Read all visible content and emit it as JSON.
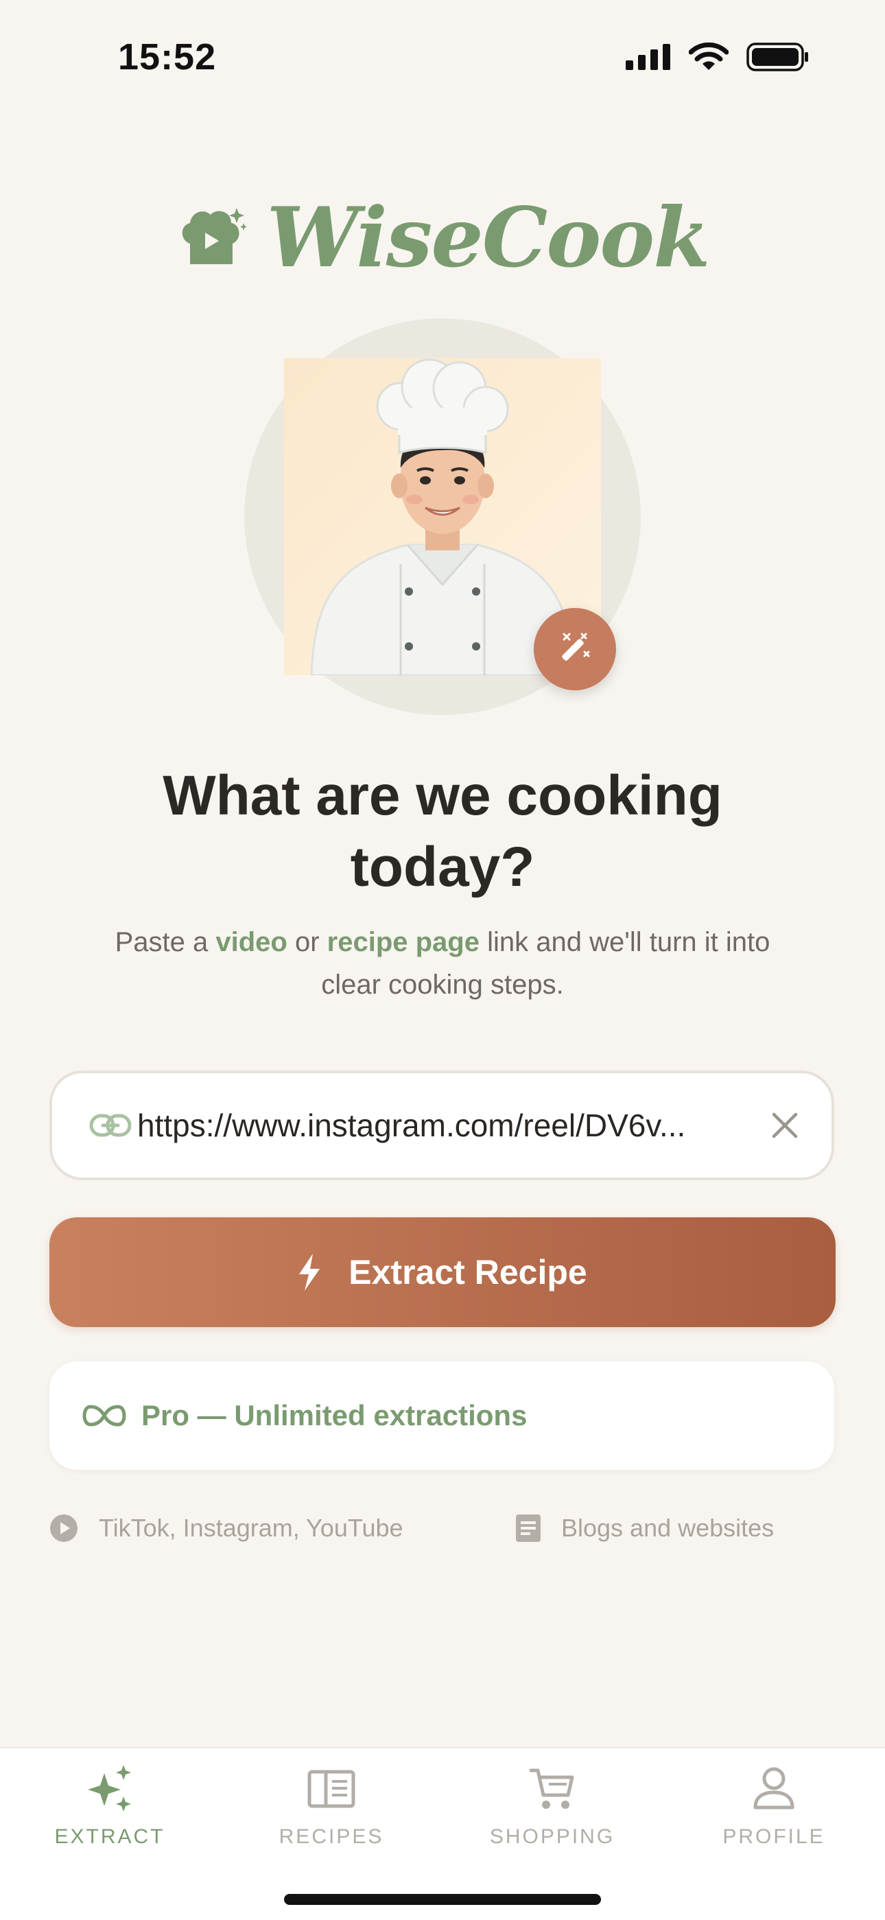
{
  "status_bar": {
    "time": "15:52"
  },
  "app": {
    "name": "WiseCook"
  },
  "hero": {
    "title": "What are we cooking today?",
    "subtitle_part1": "Paste a ",
    "subtitle_video": "video",
    "subtitle_part2": " or ",
    "subtitle_recipe": "recipe page",
    "subtitle_part3": " link and we'll turn it into clear cooking steps."
  },
  "url_input": {
    "value": "https://www.instagram.com/reel/DV6v..."
  },
  "extract_button": {
    "label": "Extract Recipe"
  },
  "pro_card": {
    "label": "Pro — Unlimited extractions"
  },
  "sources": [
    {
      "icon": "play-circle-icon",
      "label": "TikTok, Instagram, YouTube"
    },
    {
      "icon": "document-icon",
      "label": "Blogs and websites"
    }
  ],
  "tabs": [
    {
      "icon": "sparkles-icon",
      "label": "EXTRACT",
      "active": true
    },
    {
      "icon": "book-icon",
      "label": "RECIPES",
      "active": false
    },
    {
      "icon": "cart-icon",
      "label": "SHOPPING",
      "active": false
    },
    {
      "icon": "person-icon",
      "label": "PROFILE",
      "active": false
    }
  ],
  "colors": {
    "accent_green": "#7a9b70",
    "button_terracotta": "#c27655",
    "background": "#f8f5f0"
  }
}
